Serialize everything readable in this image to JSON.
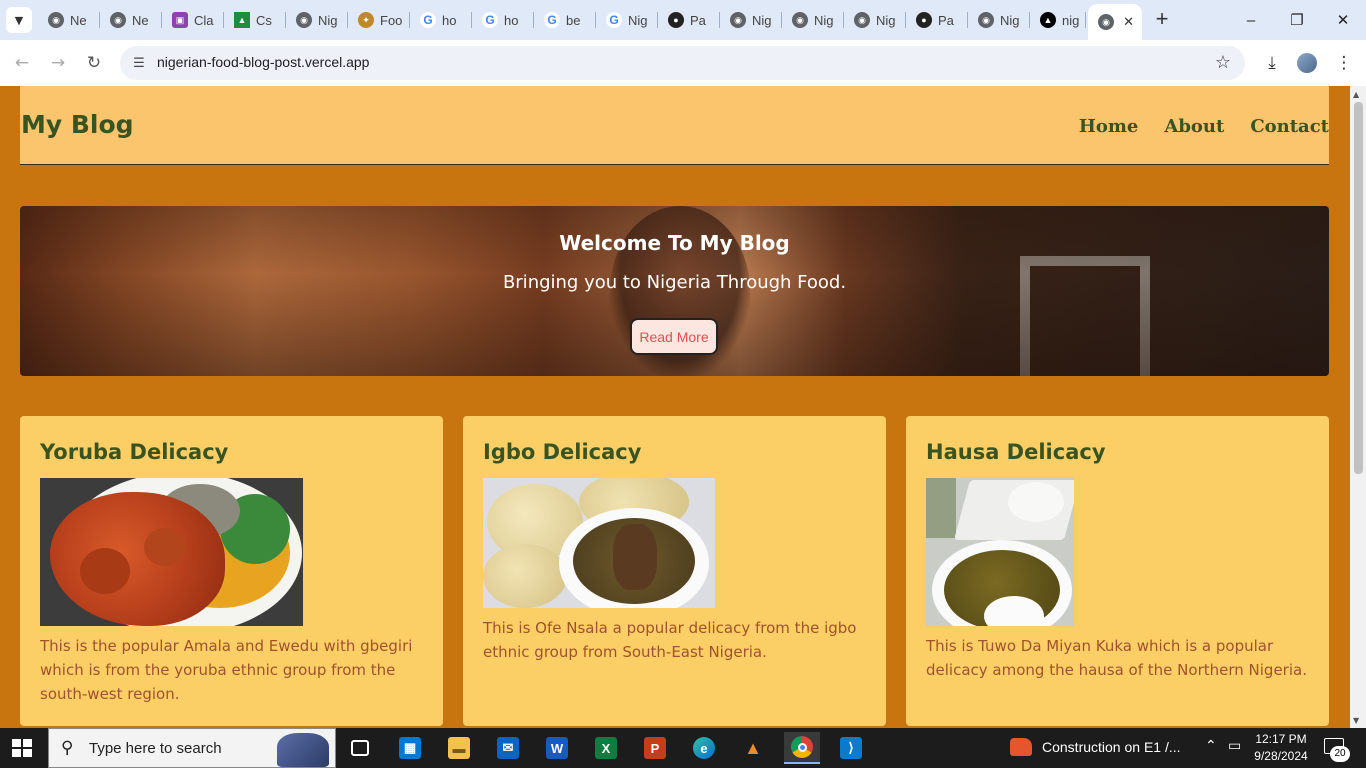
{
  "browser": {
    "tabs": [
      {
        "label": "Ne",
        "favicon": "globe-icon",
        "color": "#5f6368"
      },
      {
        "label": "Ne",
        "favicon": "globe-icon",
        "color": "#5f6368"
      },
      {
        "label": "Cla",
        "favicon": "classroom-icon",
        "color": "#8e44ad"
      },
      {
        "label": "Cs",
        "favicon": "drive-icon",
        "color": "#1e8e3e"
      },
      {
        "label": "Nig",
        "favicon": "globe-icon",
        "color": "#5f6368"
      },
      {
        "label": "Foo",
        "favicon": "chef-icon",
        "color": "#c0872c"
      },
      {
        "label": "ho",
        "favicon": "google-icon",
        "color": "#4285f4"
      },
      {
        "label": "ho",
        "favicon": "google-icon",
        "color": "#4285f4"
      },
      {
        "label": "be",
        "favicon": "google-icon",
        "color": "#4285f4"
      },
      {
        "label": "Nig",
        "favicon": "google-icon",
        "color": "#4285f4"
      },
      {
        "label": "Pa",
        "favicon": "github-icon",
        "color": "#222222"
      },
      {
        "label": "Nig",
        "favicon": "globe-icon",
        "color": "#5f6368"
      },
      {
        "label": "Nig",
        "favicon": "globe-icon",
        "color": "#5f6368"
      },
      {
        "label": "Nig",
        "favicon": "globe-icon",
        "color": "#5f6368"
      },
      {
        "label": "Pa",
        "favicon": "github-icon",
        "color": "#222222"
      },
      {
        "label": "Nig",
        "favicon": "globe-icon",
        "color": "#5f6368"
      },
      {
        "label": "nig",
        "favicon": "vercel-icon",
        "color": "#000000"
      }
    ],
    "active_tab": {
      "favicon": "globe-icon",
      "close": "✕"
    },
    "url": "nigerian-food-blog-post.vercel.app"
  },
  "site": {
    "logo": "My Blog",
    "nav": [
      "Home",
      "About",
      "Contact"
    ]
  },
  "hero": {
    "title": "Welcome To My Blog",
    "subtitle": "Bringing you to Nigeria Through Food.",
    "button": "Read More"
  },
  "cards": [
    {
      "title": "Yoruba Delicacy",
      "text": "This is the popular Amala and Ewedu with gbegiri which is from the yoruba ethnic group from the south-west region."
    },
    {
      "title": "Igbo Delicacy",
      "text": "This is Ofe Nsala a popular delicacy from the igbo ethnic group from South-East Nigeria."
    },
    {
      "title": "Hausa Delicacy",
      "text": "This is Tuwo Da Miyan Kuka which is a popular delicacy among the hausa of the Northern Nigeria."
    }
  ],
  "taskbar": {
    "search_placeholder": "Type here to search",
    "weather_text": "Construction on E1 /...",
    "time": "12:17 PM",
    "date": "9/28/2024",
    "notification_count": "20"
  },
  "colors": {
    "page_bg": "#c8750f",
    "header_bg": "#fbc56d",
    "card_bg": "#fccf66",
    "heading_green": "#395321",
    "body_text": "#a0522d"
  }
}
